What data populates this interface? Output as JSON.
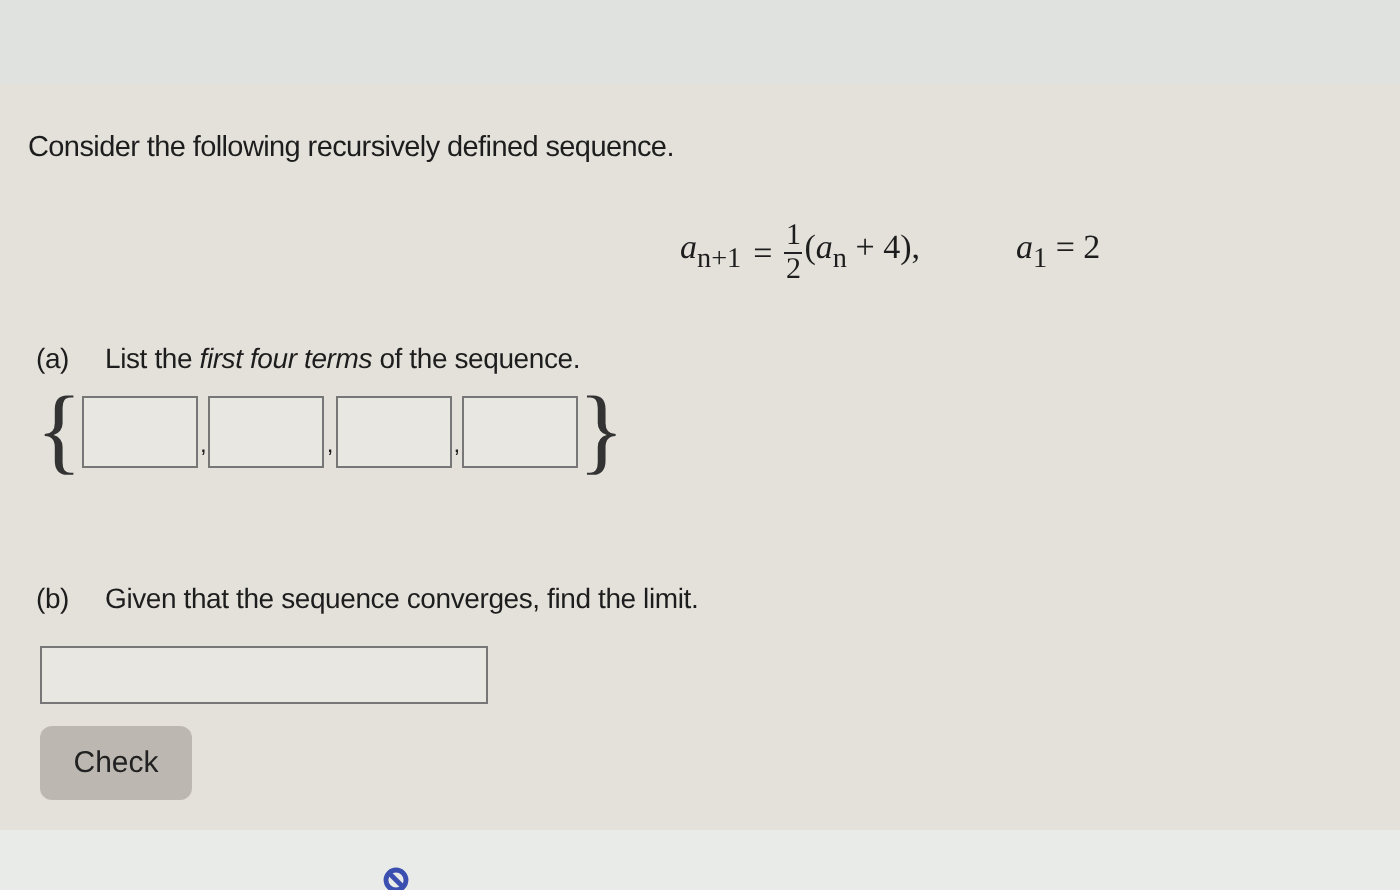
{
  "intro": "Consider the following recursively defined sequence.",
  "formula": {
    "lhs": "*a*$_{n+1}$",
    "equals": "=",
    "numerator": "1",
    "denominator": "2",
    "rhs": "(*a*$_{n}$ + 4),",
    "initial": "*a*$_{1}$ = 2"
  },
  "parts": [
    {
      "kind": "list",
      "label": "(a)",
      "prompt": "List the *first four terms* of the sequence.",
      "open_brace": "{",
      "close_brace": "}",
      "separator": ",",
      "fields": [
        {
          "kind": "blank"
        },
        {
          "kind": "blank"
        },
        {
          "kind": "blank"
        },
        {
          "kind": "blank"
        }
      ]
    },
    {
      "kind": "single",
      "label": "(b)",
      "prompt": "Given that the sequence converges, find the limit.",
      "fields": [
        {
          "kind": "blank"
        }
      ]
    }
  ],
  "button": "Check"
}
